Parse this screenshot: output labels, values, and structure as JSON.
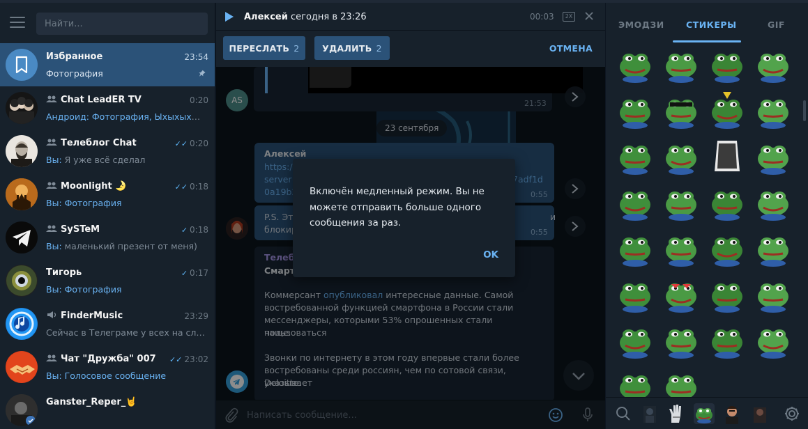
{
  "sidebar": {
    "search_placeholder": "Найти...",
    "chats": [
      {
        "name": "Избранное",
        "time": "23:54",
        "preview_prefix": "",
        "preview": "Фотография",
        "group": false,
        "pinned": true,
        "active": true,
        "read": false
      },
      {
        "name": "Chat LeadER TV",
        "time": "0:20",
        "preview_prefix": "Андроид: ",
        "preview": "Фотография, Ыхыхыхыхы",
        "group": true,
        "pinned": false,
        "active": false,
        "read": false
      },
      {
        "name": "Теleблог Chat",
        "time": "0:20",
        "preview_prefix": "Вы: ",
        "preview": "Я уже всё сделал",
        "group": true,
        "pinned": false,
        "active": false,
        "read": true
      },
      {
        "name": "Moonlight 🌛",
        "time": "0:18",
        "preview_prefix": "Вы: ",
        "preview": "Фотография",
        "group": true,
        "pinned": false,
        "active": false,
        "read": true
      },
      {
        "name": "SySTeM",
        "time": "0:18",
        "preview_prefix": "Вы: ",
        "preview": "маленький презент от меня)",
        "group": true,
        "pinned": false,
        "active": false,
        "read": true
      },
      {
        "name": "Тигорь",
        "time": "0:17",
        "preview_prefix": "Вы: ",
        "preview": "Фотография",
        "group": false,
        "pinned": false,
        "active": false,
        "read": true
      },
      {
        "name": "FinderMusic",
        "time": "23:29",
        "preview_prefix": "",
        "preview": "Сейчас в Телеграме у всех на слуху ...",
        "group": false,
        "channel": true,
        "pinned": false,
        "active": false,
        "read": false
      },
      {
        "name": "Чат \"Дружба\" 007",
        "time": "23:02",
        "preview_prefix": "Вы: ",
        "preview": "Голосовое сообщение",
        "group": true,
        "pinned": false,
        "active": false,
        "read": true
      },
      {
        "name": "Ganster_Reper_🤘",
        "time": "",
        "preview_prefix": "",
        "preview": "",
        "group": false,
        "pinned": false,
        "active": false,
        "read": false
      }
    ]
  },
  "player": {
    "author": "Алексей",
    "when": "сегодня в 23:26",
    "time": "00:03",
    "speed": "2X"
  },
  "selection": {
    "forward_label": "Переслать",
    "forward_count": "2",
    "delete_label": "Удалить",
    "delete_count": "2",
    "cancel_label": "Отмена"
  },
  "messages": {
    "photo_time": "21:53",
    "date_label": "23 сентября",
    "m1": {
      "sender": "Алексей",
      "line1": "https:/",
      "line2": "server=",
      "line2_end": "7adf1d",
      "line3": "0a19b2",
      "time": "0:55"
    },
    "m2": {
      "line1": "P.S. Это",
      "line1_end": "и",
      "line2": "блокир",
      "time": "0:55"
    },
    "m3": {
      "channel": "Телебл",
      "title": "Смарт",
      "p1_a": "Коммерсант ",
      "p1_link": "опубликовал",
      "p1_b": " интересные данные. Самой",
      "p1_l2": "востребованной функцией смартфона в России стали",
      "p1_l3": "мессенджеры, которыми 53% опрошенных стали пользоваться",
      "p1_l4": "чаще.",
      "p2_l1": "Звонки по интернету в этом году впервые стали более",
      "p2_l2": "востребованы среди россиян, чем по сотовой связи, указывает",
      "p2_l3": "Deloitte."
    },
    "avatar_initials": "AS"
  },
  "composer": {
    "placeholder": "Написать сообщение..."
  },
  "dialog": {
    "text": "Включён медленный режим. Вы не можете отправить больше одного сообщения за раз.",
    "ok_label": "OK"
  },
  "right_panel": {
    "tabs": [
      "Эмодзи",
      "Стикеры",
      "GIF"
    ],
    "active_tab": 1
  },
  "colors": {
    "accent": "#6ab3f3",
    "active_chat": "#2b5278",
    "panel": "#17212b",
    "background": "#0e1621"
  }
}
